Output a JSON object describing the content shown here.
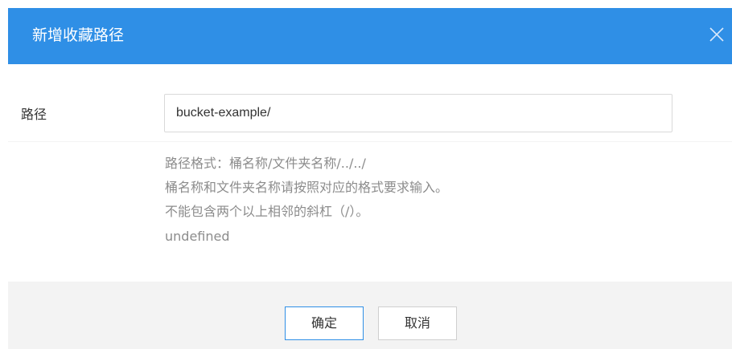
{
  "dialog": {
    "title": "新增收藏路径",
    "close_icon": "close-icon"
  },
  "form": {
    "path_label": "路径",
    "path_value": "bucket-example/",
    "hints": [
      "路径格式：桶名称/文件夹名称/../../",
      "桶名称和文件夹名称请按照对应的格式要求输入。",
      "不能包含两个以上相邻的斜杠（/）。",
      "undefined"
    ]
  },
  "footer": {
    "ok_label": "确定",
    "cancel_label": "取消"
  },
  "colors": {
    "header_bg": "#2f8fe6",
    "footer_bg": "#f3f3f3",
    "hint_text": "#8c8c8c"
  }
}
